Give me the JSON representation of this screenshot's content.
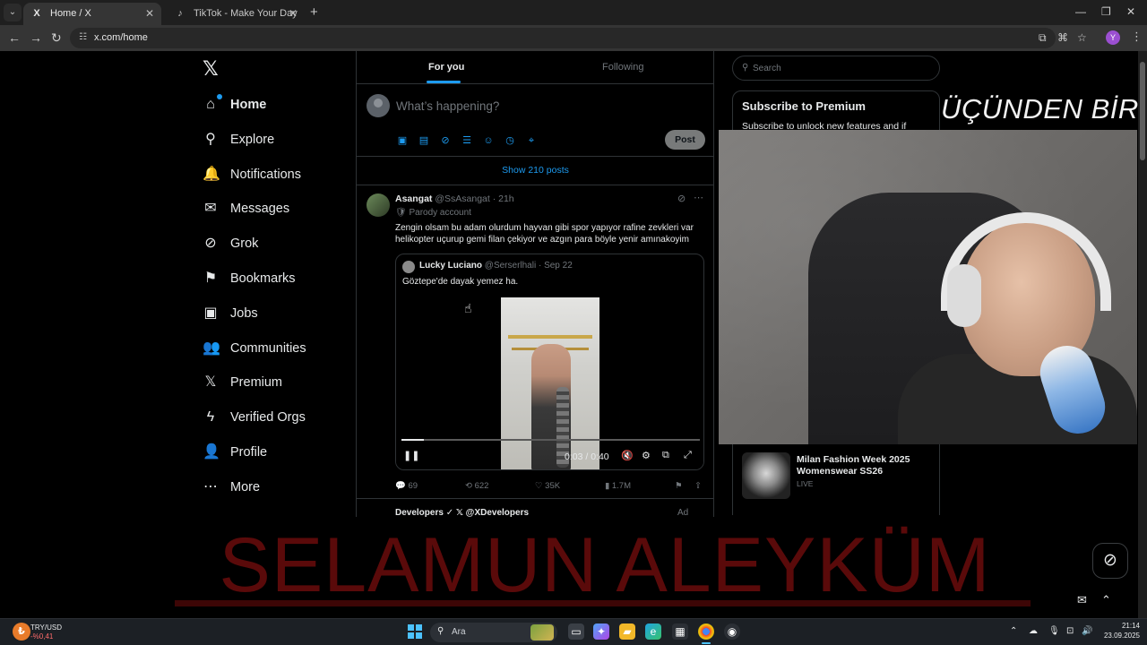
{
  "browser": {
    "tabs": [
      {
        "title": "Home / X",
        "favicon": "X",
        "close": "✕"
      },
      {
        "title": "TikTok - Make Your Day",
        "favicon": "♪",
        "close": "✕"
      }
    ],
    "new_tab": "+",
    "url": "x.com/home",
    "window_controls": [
      "—",
      "❐",
      "✕"
    ]
  },
  "nav": {
    "logo": "𝕏",
    "items": [
      {
        "label": "Home",
        "icon": "home-icon",
        "glyph": "⌂"
      },
      {
        "label": "Explore",
        "icon": "search-icon",
        "glyph": "⚲"
      },
      {
        "label": "Notifications",
        "icon": "bell-icon",
        "glyph": "🔔"
      },
      {
        "label": "Messages",
        "icon": "envelope-icon",
        "glyph": "✉"
      },
      {
        "label": "Grok",
        "icon": "grok-icon",
        "glyph": "⊘"
      },
      {
        "label": "Bookmarks",
        "icon": "bookmark-icon",
        "glyph": "⚑"
      },
      {
        "label": "Jobs",
        "icon": "briefcase-icon",
        "glyph": "▣"
      },
      {
        "label": "Communities",
        "icon": "people-icon",
        "glyph": "👥"
      },
      {
        "label": "Premium",
        "icon": "x-premium-icon",
        "glyph": "𝕏"
      },
      {
        "label": "Verified Orgs",
        "icon": "lightning-icon",
        "glyph": "ϟ"
      },
      {
        "label": "Profile",
        "icon": "person-icon",
        "glyph": "👤"
      },
      {
        "label": "More",
        "icon": "more-circle-icon",
        "glyph": "⋯"
      }
    ]
  },
  "feed": {
    "tabs": [
      "For you",
      "Following"
    ],
    "composer": {
      "placeholder": "What’s happening?",
      "post_label": "Post"
    },
    "show_posts": "Show 210 posts",
    "tweet": {
      "name": "Asangat",
      "handle": "@SsAsangat · 21h",
      "badge": "🛡 Parody account",
      "text": "Zengin olsam bu adam olurdum hayvan gibi spor yapıyor rafine zevkleri var helikopter uçurup gemi filan çekiyor ve azgın para böyle yenir amınakoyim",
      "quote": {
        "name": "Lucky Luciano",
        "handle": "@Serserlhali · Sep 22",
        "text": "Göztepe'de dayak yemez ha.",
        "video_time": "0:03 / 0:40",
        "progress": 0.075
      },
      "actions": {
        "replies": "69",
        "reposts": "622",
        "likes": "35K",
        "views": "1.7M"
      }
    },
    "next": {
      "name": "Developers ✓ 𝕏 @XDevelopers",
      "ad": "Ad"
    }
  },
  "right": {
    "search_placeholder": "Search",
    "premium": {
      "title": "Subscribe to Premium",
      "desc": "Subscribe to unlock new features and if"
    },
    "trend": {
      "title": "Milan Fashion Week 2025 Womenswear SS26",
      "status": "LIVE"
    }
  },
  "overlay": {
    "top_text": "ÜÇÜNDEN BİRİ",
    "big_text": "SELAMUN ALEYKÜM"
  },
  "taskbar": {
    "stock_name": "TRY/USD",
    "stock_change": "-%0,41",
    "search_label": "Ara",
    "time": "21:14",
    "date": "23.09.2025"
  },
  "colors": {
    "accent": "#1d9bf0",
    "overlay_red": "#5a0a0a"
  }
}
